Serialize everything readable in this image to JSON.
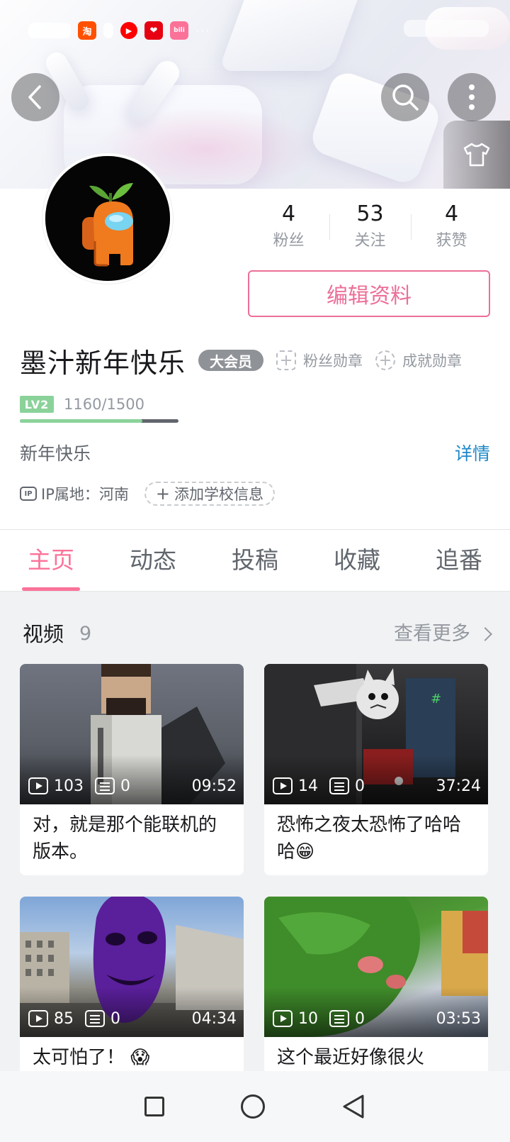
{
  "profile": {
    "username": "墨汁新年快乐",
    "vip_label": "大会员",
    "fan_medal_label": "粉丝勋章",
    "achievement_medal_label": "成就勋章",
    "level_badge": "LV2",
    "exp_text": "1160/1500",
    "exp_progress": 0.773,
    "signature": "新年快乐",
    "detail_label": "详情",
    "ip_text": "IP属地：河南",
    "ip_badge": "IP",
    "add_school_label": "添加学校信息",
    "edit_button_label": "编辑资料",
    "stats": [
      {
        "value": "4",
        "label": "粉丝"
      },
      {
        "value": "53",
        "label": "关注"
      },
      {
        "value": "4",
        "label": "获赞"
      }
    ]
  },
  "status_bar": {
    "app_icons": [
      "淘",
      "▶",
      "❤",
      "bili"
    ],
    "dots": "···"
  },
  "tabs": [
    {
      "label": "主页",
      "active": true
    },
    {
      "label": "动态",
      "active": false
    },
    {
      "label": "投稿",
      "active": false
    },
    {
      "label": "收藏",
      "active": false
    },
    {
      "label": "追番",
      "active": false
    }
  ],
  "videos_section": {
    "title": "视频",
    "count": "9",
    "more_label": "查看更多",
    "items": [
      {
        "plays": "103",
        "danmaku": "0",
        "duration": "09:52",
        "title": "对，就是那个能联机的版本。"
      },
      {
        "plays": "14",
        "danmaku": "0",
        "duration": "37:24",
        "title": "恐怖之夜太恐怖了哈哈哈😁"
      },
      {
        "plays": "85",
        "danmaku": "0",
        "duration": "04:34",
        "title": "太可怕了！ 😱"
      },
      {
        "plays": "10",
        "danmaku": "0",
        "duration": "03:53",
        "title": "这个最近好像很火"
      }
    ]
  },
  "icons": {
    "back": "back-arrow-icon",
    "search": "search-icon",
    "more": "more-vertical-icon",
    "skin": "tshirt-icon"
  },
  "colors": {
    "accent_pink": "#fb7299",
    "edit_border": "#ec6f97",
    "link_blue": "#1e88c8",
    "level_green": "#8bd29a"
  }
}
